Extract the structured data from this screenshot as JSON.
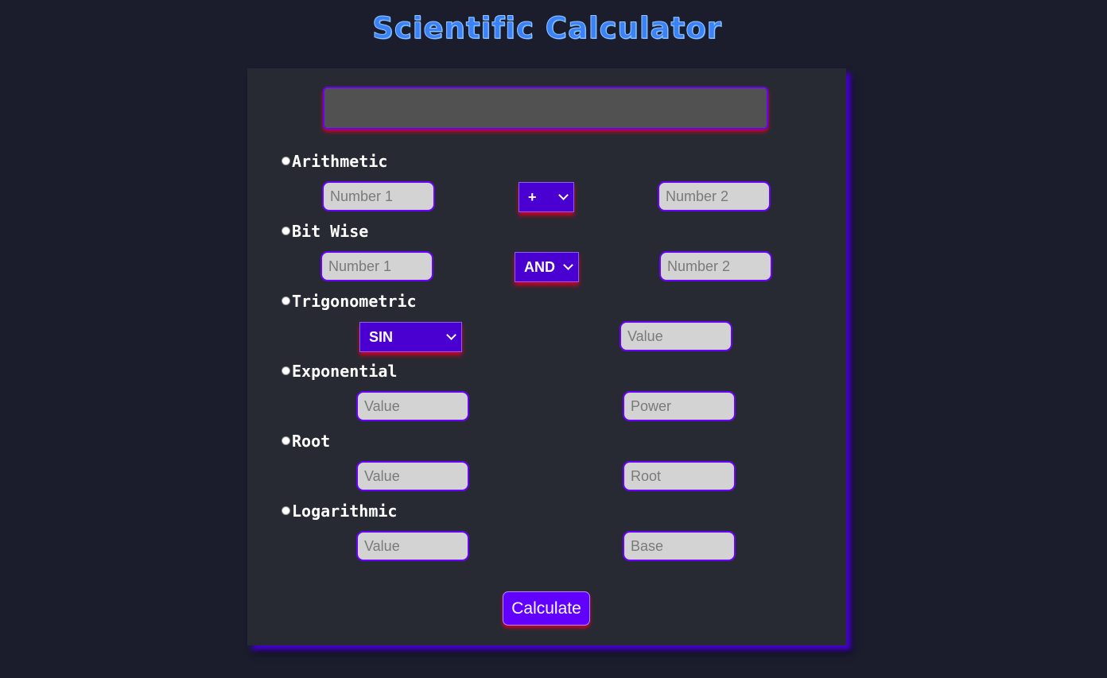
{
  "title": "Scientific Calculator",
  "display": {
    "value": ""
  },
  "sections": {
    "arithmetic": {
      "label": "Arithmetic",
      "number1_placeholder": "Number 1",
      "operator_selected": "+",
      "number2_placeholder": "Number 2"
    },
    "bitwise": {
      "label": "Bit Wise",
      "number1_placeholder": "Number 1",
      "operator_selected": "AND",
      "number2_placeholder": "Number 2"
    },
    "trigonometric": {
      "label": "Trigonometric",
      "function_selected": "SIN",
      "value_placeholder": "Value"
    },
    "exponential": {
      "label": "Exponential",
      "value_placeholder": "Value",
      "power_placeholder": "Power"
    },
    "root": {
      "label": "Root",
      "value_placeholder": "Value",
      "root_placeholder": "Root"
    },
    "logarithmic": {
      "label": "Logarithmic",
      "value_placeholder": "Value",
      "base_placeholder": "Base"
    }
  },
  "calculate_label": "Calculate",
  "colors": {
    "background": "#1b1d2d",
    "panel": "#282a33",
    "accent": "#6200ff",
    "glow": "#d10024",
    "title": "#3b82f6"
  }
}
